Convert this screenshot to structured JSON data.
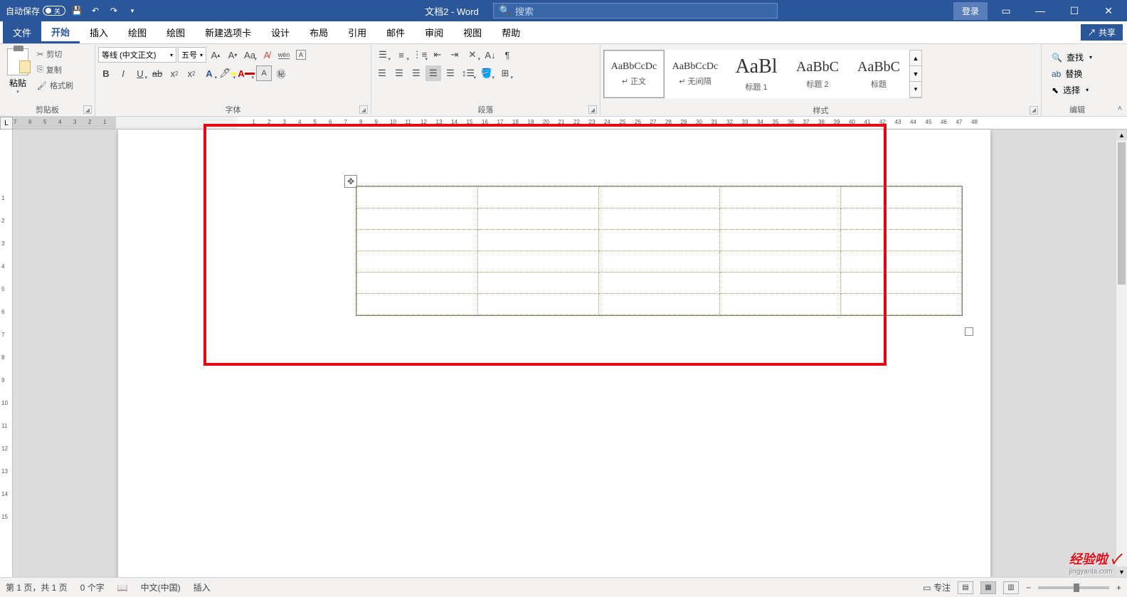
{
  "title_bar": {
    "autosave_label": "自动保存",
    "toggle_state": "关",
    "doc_title": "文档2 - Word",
    "search_placeholder": "搜索",
    "login_label": "登录"
  },
  "menu": {
    "file": "文件",
    "home": "开始",
    "insert": "插入",
    "draw1": "绘图",
    "draw2": "绘图",
    "newtab": "新建选项卡",
    "design": "设计",
    "layout": "布局",
    "references": "引用",
    "mail": "邮件",
    "review": "审阅",
    "view": "视图",
    "help": "帮助",
    "share": "共享"
  },
  "ribbon": {
    "clipboard": {
      "title": "剪贴板",
      "paste": "粘贴",
      "cut": "剪切",
      "copy": "复制",
      "format": "格式刷"
    },
    "font": {
      "title": "字体",
      "name": "等线 (中文正文)",
      "size": "五号"
    },
    "paragraph": {
      "title": "段落"
    },
    "styles": {
      "title": "样式",
      "items": [
        {
          "preview": "AaBbCcDc",
          "label": "正文",
          "size": "14px",
          "selected": true,
          "prefix": "↵ "
        },
        {
          "preview": "AaBbCcDc",
          "label": "无间隔",
          "size": "14px",
          "selected": false,
          "prefix": "↵ "
        },
        {
          "preview": "AaBl",
          "label": "标题 1",
          "size": "28px",
          "selected": false,
          "prefix": ""
        },
        {
          "preview": "AaBbC",
          "label": "标题 2",
          "size": "20px",
          "selected": false,
          "prefix": ""
        },
        {
          "preview": "AaBbC",
          "label": "标题",
          "size": "20px",
          "selected": false,
          "prefix": ""
        }
      ]
    },
    "editing": {
      "title": "编辑",
      "find": "查找",
      "replace": "替换",
      "select": "选择"
    }
  },
  "status": {
    "page": "第 1 页，共 1 页",
    "words": "0 个字",
    "lang": "中文(中国)",
    "mode": "插入",
    "focus": "专注"
  },
  "watermark": {
    "main": "经验啦 ✓",
    "sub": "jingyanla.com"
  }
}
